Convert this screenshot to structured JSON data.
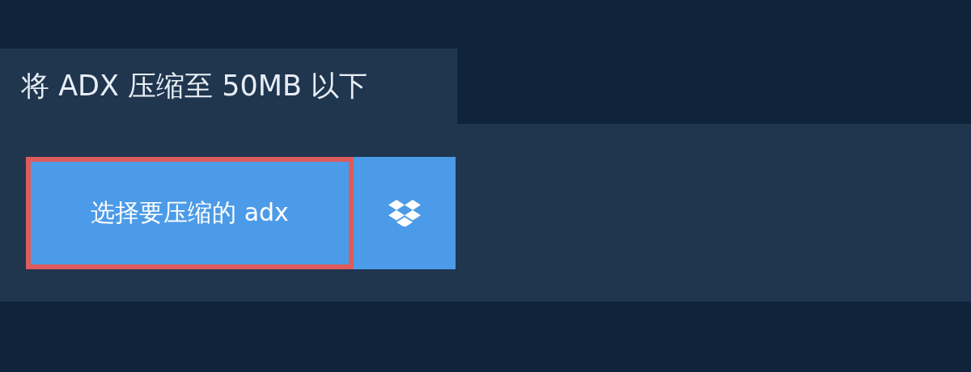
{
  "tab": {
    "title": "将 ADX 压缩至 50MB 以下"
  },
  "upload": {
    "choose_button": {
      "label": "选择要压缩的 adx",
      "focused": true
    },
    "dropbox_button": {
      "kind": "dropbox"
    }
  }
}
